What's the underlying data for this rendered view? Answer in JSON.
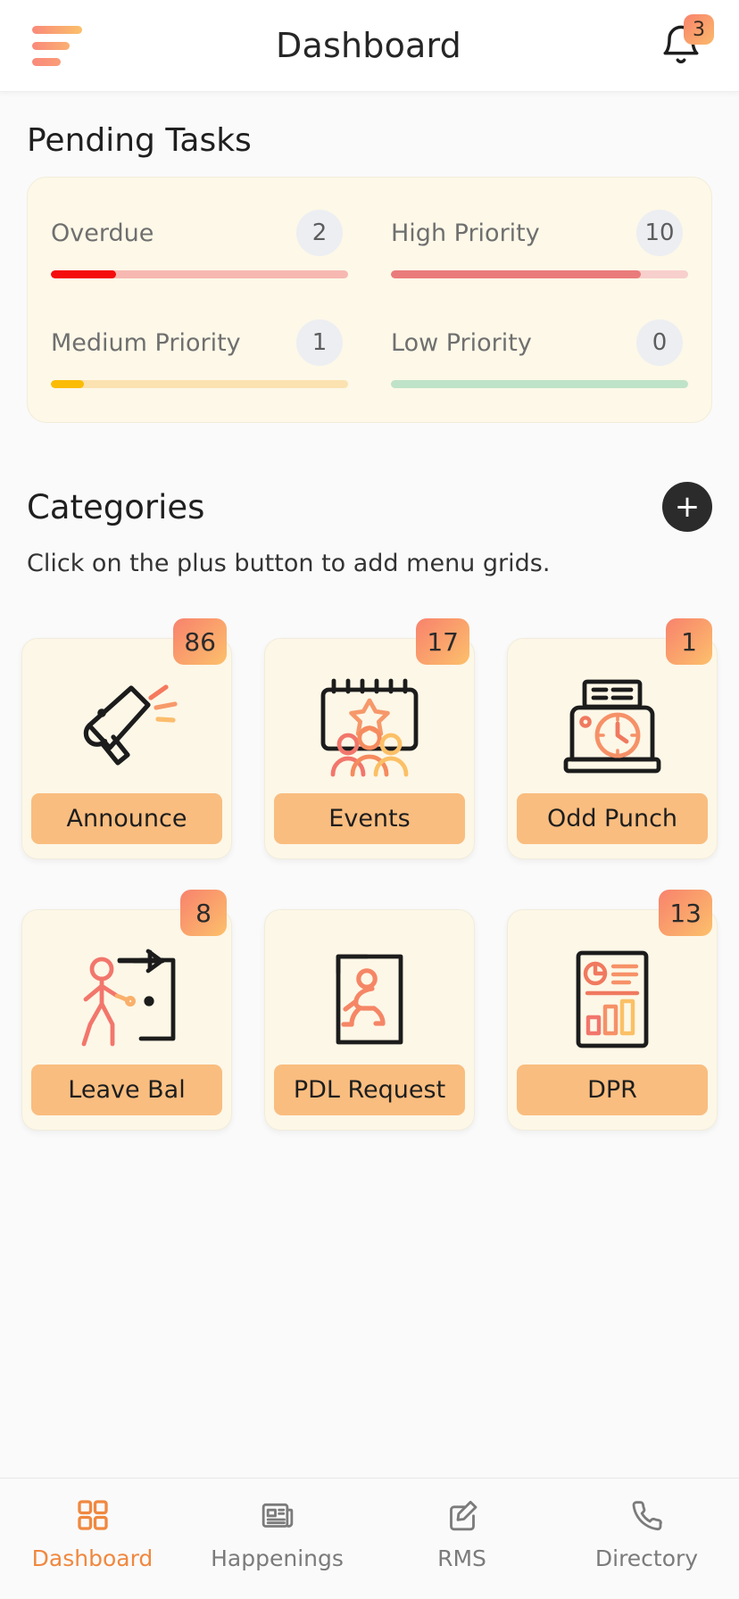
{
  "header": {
    "title": "Dashboard",
    "menu_icon": "hamburger-menu-icon",
    "notification_icon": "bell-icon",
    "notification_count": "3"
  },
  "pending_tasks": {
    "section_title": "Pending Tasks",
    "items": [
      {
        "label": "Overdue",
        "count": "2",
        "percent": 22,
        "fill_color": "#f50c0c",
        "track_color": "#f7b8b2"
      },
      {
        "label": "High Priority",
        "count": "10",
        "percent": 84,
        "fill_color": "#ea7b7b",
        "track_color": "#f7cfcc"
      },
      {
        "label": "Medium Priority",
        "count": "1",
        "percent": 11,
        "fill_color": "#fbbc05",
        "track_color": "#fbe2b0"
      },
      {
        "label": "Low Priority",
        "count": "0",
        "percent": 0,
        "fill_color": "#a9ddb9",
        "track_color": "#bfe3c8"
      }
    ]
  },
  "categories": {
    "title": "Categories",
    "add_button_label": "+",
    "subtitle": "Click on the plus button to add menu grids.",
    "cards": [
      {
        "label": "Announce",
        "badge": "86",
        "icon": "megaphone-icon"
      },
      {
        "label": "Events",
        "badge": "17",
        "icon": "calendar-people-icon"
      },
      {
        "label": "Odd Punch",
        "badge": "1",
        "icon": "punch-clock-icon"
      },
      {
        "label": "Leave Bal",
        "badge": "8",
        "icon": "person-exit-door-icon"
      },
      {
        "label": "PDL Request",
        "badge": "",
        "icon": "person-running-icon"
      },
      {
        "label": "DPR",
        "badge": "13",
        "icon": "report-document-icon"
      }
    ]
  },
  "bottom_nav": {
    "items": [
      {
        "label": "Dashboard",
        "icon": "grid-icon",
        "active": true
      },
      {
        "label": "Happenings",
        "icon": "news-icon",
        "active": false
      },
      {
        "label": "RMS",
        "icon": "edit-note-icon",
        "active": false
      },
      {
        "label": "Directory",
        "icon": "phone-icon",
        "active": false
      }
    ]
  },
  "colors": {
    "accent": "#f0883f",
    "card_bg": "#fdf7e7",
    "label_pill": "#f9bd7f",
    "badge_gradient_start": "#f8826d",
    "badge_gradient_end": "#fcc06b"
  }
}
